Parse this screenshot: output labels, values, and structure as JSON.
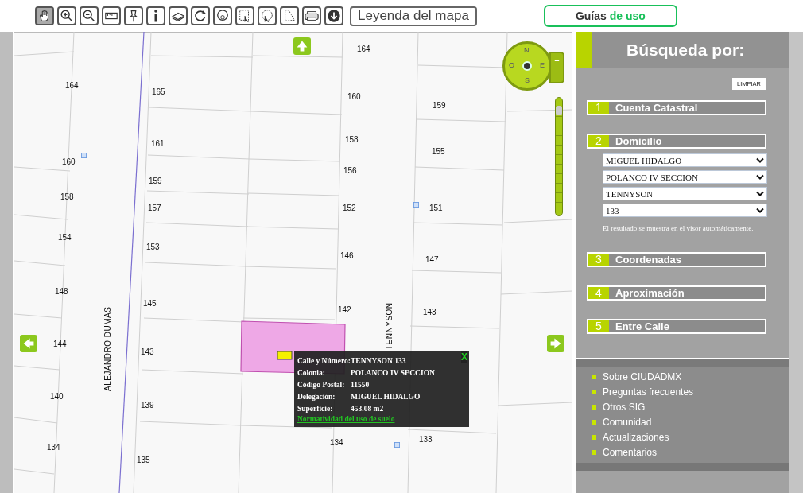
{
  "toolbar": {
    "tools": [
      {
        "kind": "pan",
        "selected": true
      },
      {
        "kind": "zoom-in",
        "selected": false
      },
      {
        "kind": "zoom-out",
        "selected": false
      },
      {
        "kind": "measure",
        "selected": false
      },
      {
        "kind": "pin",
        "selected": false
      },
      {
        "kind": "info",
        "selected": false
      },
      {
        "kind": "layers",
        "selected": false
      },
      {
        "kind": "refresh",
        "selected": false
      },
      {
        "kind": "select-point",
        "selected": false
      },
      {
        "kind": "select-box",
        "selected": false
      },
      {
        "kind": "select-circle",
        "selected": false
      },
      {
        "kind": "select-polygon",
        "selected": false
      },
      {
        "kind": "print",
        "selected": false
      },
      {
        "kind": "download",
        "selected": false
      }
    ],
    "legend_button": "Leyenda del mapa",
    "guides_button": {
      "text": "Guías",
      "accent": "de uso"
    }
  },
  "map": {
    "lot_numbers": [
      "164",
      "164",
      "165",
      "160",
      "159",
      "161",
      "158",
      "155",
      "160",
      "156",
      "158",
      "159",
      "157",
      "152",
      "151",
      "154",
      "153",
      "146",
      "147",
      "148",
      "145",
      "142",
      "143",
      "144",
      "143",
      "140",
      "139",
      "134",
      "133",
      "134",
      "135"
    ],
    "streets": [
      "ALEJANDRO DUMAS",
      "TENNYSON"
    ],
    "compass": {
      "north": "N",
      "west": "O",
      "east": "E",
      "south": "S",
      "zoom_in": "+",
      "zoom_out": "-"
    },
    "zoom_slider": {
      "level": 0.93
    },
    "popup": {
      "rows": [
        {
          "label": "Calle y Número:",
          "value": "TENNYSON 133"
        },
        {
          "label": "Colonia:",
          "value": "POLANCO IV SECCION"
        },
        {
          "label": "Código Postal:",
          "value": "11550"
        },
        {
          "label": "Delegación:",
          "value": "MIGUEL HIDALGO"
        },
        {
          "label": "Superficie:",
          "value": "453.08 m2"
        }
      ],
      "link": "Normatividad del uso de suelo",
      "close": "X"
    }
  },
  "sidebar": {
    "title": "Búsqueda por:",
    "clear_button": "LIMPIAR",
    "sections": [
      {
        "number": "1",
        "label": "Cuenta Catastral"
      },
      {
        "number": "2",
        "label": "Domicilio",
        "selects": [
          "MIGUEL HIDALGO",
          "POLANCO IV SECCION",
          "TENNYSON",
          "133"
        ],
        "note": "El resultado se muestra en el visor automáticamente."
      },
      {
        "number": "3",
        "label": "Coordenadas"
      },
      {
        "number": "4",
        "label": "Aproximación"
      },
      {
        "number": "5",
        "label": "Entre Calle"
      }
    ],
    "links": [
      "Sobre CIUDADMX",
      "Preguntas frecuentes",
      "Otros SIG",
      "Comunidad",
      "Actualizaciones",
      "Comentarios"
    ]
  }
}
